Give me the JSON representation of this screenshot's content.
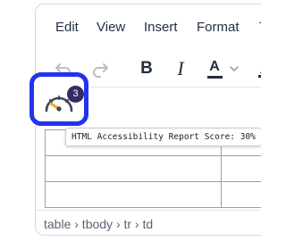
{
  "menubar": {
    "items": [
      {
        "label": "Edit"
      },
      {
        "label": "View"
      },
      {
        "label": "Insert"
      },
      {
        "label": "Format"
      },
      {
        "label": "T"
      }
    ]
  },
  "toolbar": {
    "undo_icon": "undo-icon",
    "redo_icon": "redo-icon",
    "bold_label": "B",
    "italic_label": "I",
    "text_color_label": "A",
    "text_color_accent": "#222f3e"
  },
  "accessibility_checker": {
    "icon": "gauge-icon",
    "issue_count": "3",
    "tooltip": "HTML Accessibility Report Score: 30%",
    "score_percent": 30,
    "highlight_color": "#2233ee",
    "badge_color": "#352a66",
    "needle_color": "#f4a825"
  },
  "statusbar": {
    "path": "table › tbody › tr › td"
  }
}
